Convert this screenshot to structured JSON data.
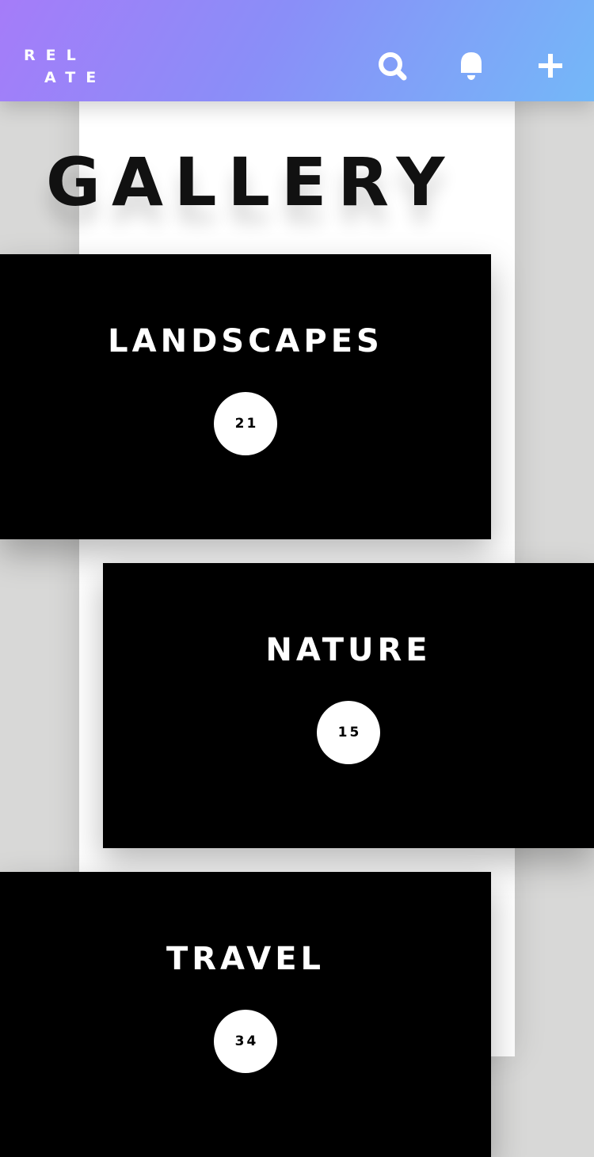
{
  "header": {
    "logo_line1": "REL",
    "logo_line2": "ATE",
    "icons": [
      "search-icon",
      "bell-icon",
      "plus-icon"
    ],
    "gradient_start": "#a57cf9",
    "gradient_end": "#74b8f8"
  },
  "page": {
    "title": "GALLERY"
  },
  "albums": [
    {
      "title": "LANDSCAPES",
      "count": "21"
    },
    {
      "title": "NATURE",
      "count": "15"
    },
    {
      "title": "TRAVEL",
      "count": "34"
    }
  ]
}
